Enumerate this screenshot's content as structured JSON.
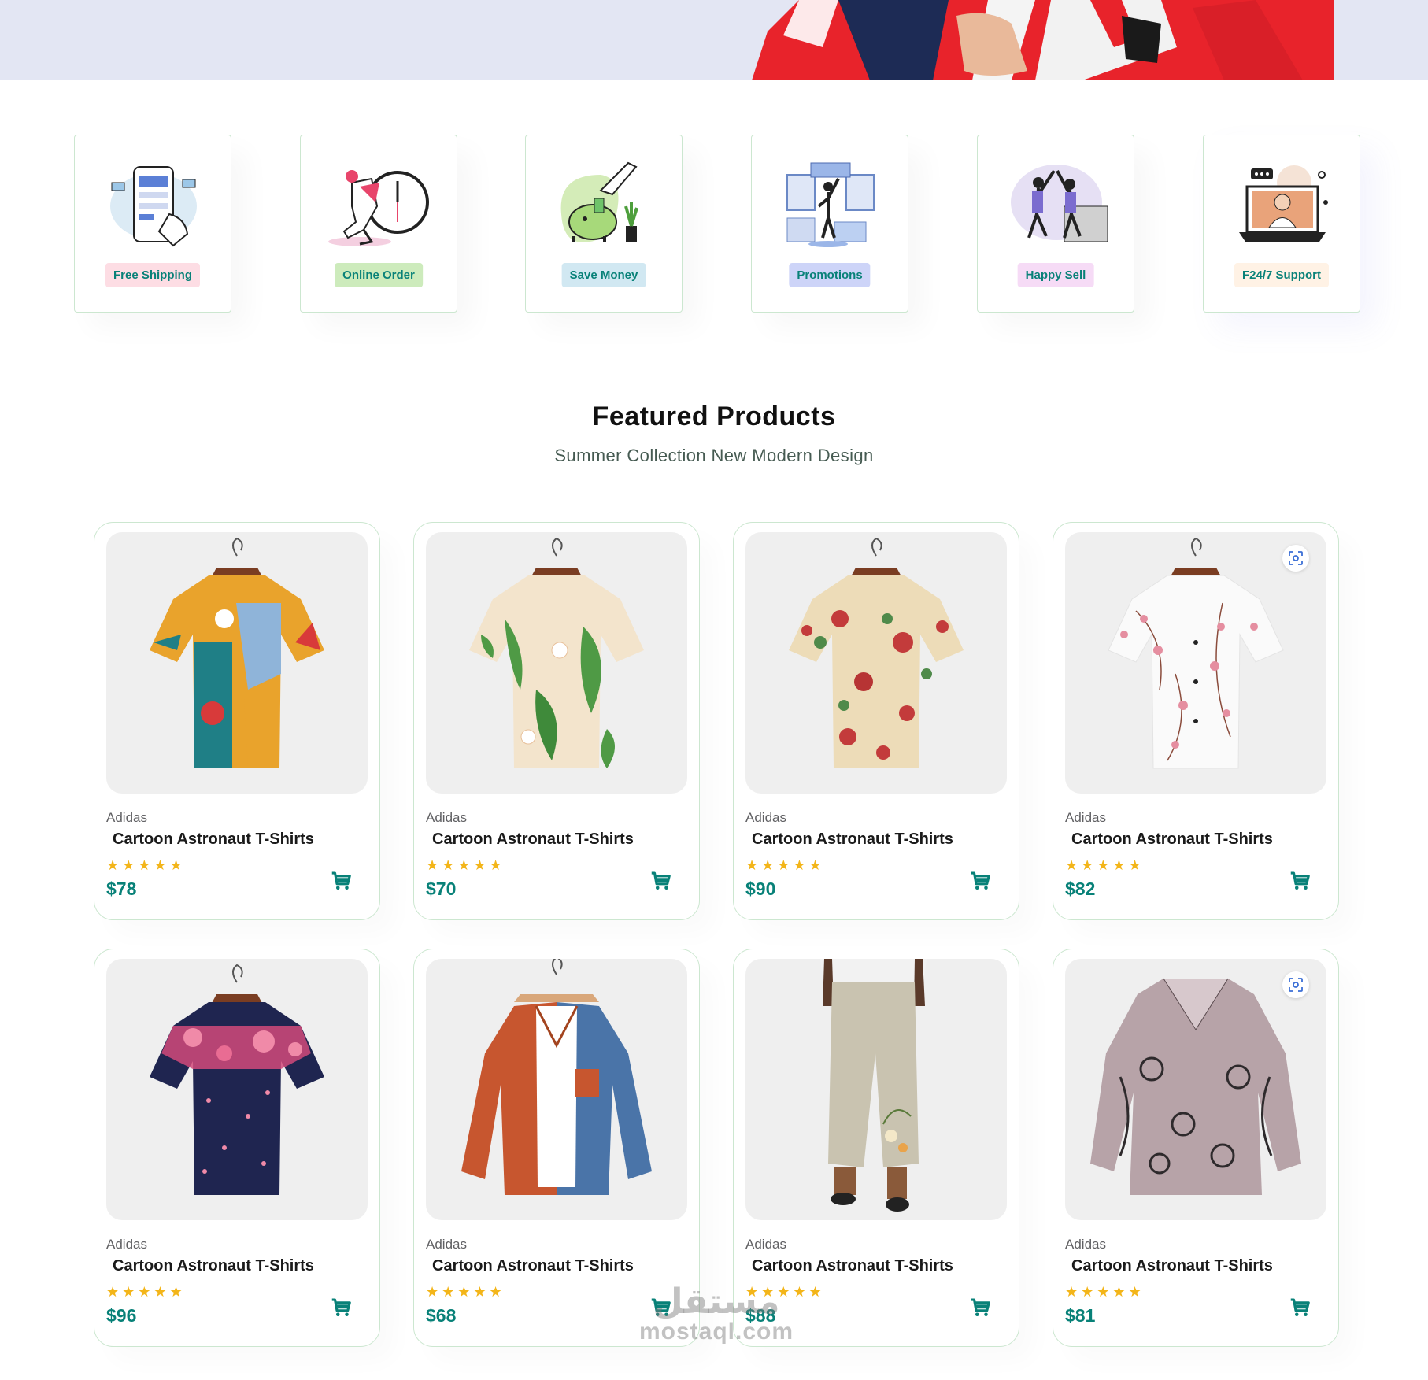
{
  "features": [
    {
      "label": "Free Shipping",
      "bg": "#fddde4",
      "icon": "phone-payment-illustration"
    },
    {
      "label": "Online Order",
      "bg": "#cdebbc",
      "icon": "delivery-clock-illustration"
    },
    {
      "label": "Save Money",
      "bg": "#d1e8f2",
      "icon": "piggy-bank-illustration"
    },
    {
      "label": "Promotions",
      "bg": "#cdd4f8",
      "icon": "promotions-illustration"
    },
    {
      "label": "Happy Sell",
      "bg": "#f6dbf6",
      "icon": "high-five-illustration"
    },
    {
      "label": "F24/7 Support",
      "bg": "#fff2e5",
      "icon": "support-laptop-illustration"
    }
  ],
  "section": {
    "title": "Featured Products",
    "subtitle": "Summer Collection New Modern Design"
  },
  "products": [
    {
      "brand": "Adidas",
      "name": "Cartoon Astronaut T-Shirts",
      "stars": "★★★★★",
      "rating": 5,
      "price": "$78",
      "image": "colorful-pattern-shirt"
    },
    {
      "brand": "Adidas",
      "name": "Cartoon Astronaut T-Shirts",
      "stars": "★★★★★",
      "rating": 5,
      "price": "$70",
      "image": "leaf-print-shirt"
    },
    {
      "brand": "Adidas",
      "name": "Cartoon Astronaut T-Shirts",
      "stars": "★★★★★",
      "rating": 5,
      "price": "$90",
      "image": "floral-cream-shirt"
    },
    {
      "brand": "Adidas",
      "name": "Cartoon Astronaut T-Shirts",
      "stars": "★★★★★",
      "rating": 5,
      "price": "$82",
      "image": "white-blossom-shirt"
    },
    {
      "brand": "Adidas",
      "name": "Cartoon Astronaut T-Shirts",
      "stars": "★★★★★",
      "rating": 5,
      "price": "$96",
      "image": "navy-floral-shirt"
    },
    {
      "brand": "Adidas",
      "name": "Cartoon Astronaut T-Shirts",
      "stars": "★★★★★",
      "rating": 5,
      "price": "$68",
      "image": "corduroy-two-tone-shirt"
    },
    {
      "brand": "Adidas",
      "name": "Cartoon Astronaut T-Shirts",
      "stars": "★★★★★",
      "rating": 5,
      "price": "$88",
      "image": "linen-pants"
    },
    {
      "brand": "Adidas",
      "name": "Cartoon Astronaut T-Shirts",
      "stars": "★★★★★",
      "rating": 5,
      "price": "$81",
      "image": "cat-print-blouse"
    }
  ],
  "watermark": {
    "arabic": "مستقل",
    "latin": "mostaql.com"
  },
  "colors": {
    "accent": "#088178",
    "star": "#f3b519",
    "hero_bg": "#e3e6f3",
    "border": "#cce7d0"
  }
}
